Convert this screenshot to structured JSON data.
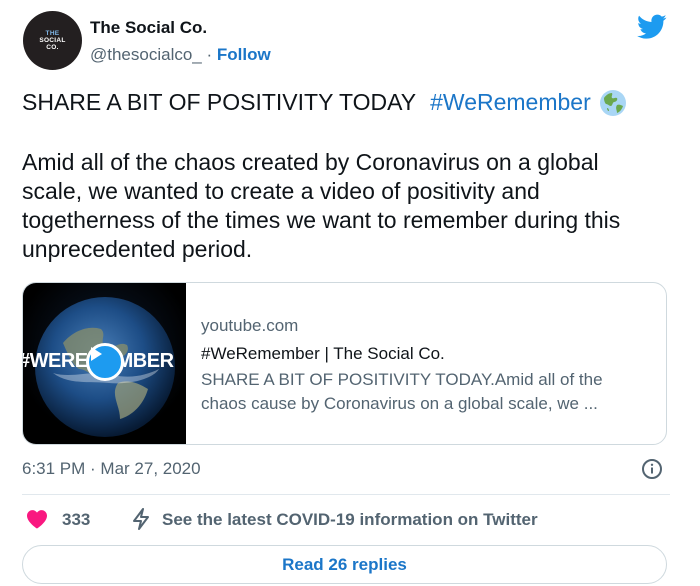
{
  "author": {
    "display_name": "The Social Co.",
    "handle": "@thesocialco_",
    "separator": " · ",
    "follow_label": "Follow",
    "avatar_text": [
      "THE",
      "SOCIAL",
      "CO."
    ]
  },
  "tweet": {
    "headline": "SHARE A BIT OF POSITIVITY TODAY",
    "hashtag": "#WeRemember",
    "body": "Amid all of the chaos created by Coronavirus on a global scale, we wanted to create a video of positivity and togetherness of the times we want to remember during this unprecedented period."
  },
  "link_card": {
    "thumbnail_text": "#WEREMEMBER",
    "domain": "youtube.com",
    "title": "#WeRemember | The Social Co.",
    "description": "SHARE A BIT OF POSITIVITY TODAY.Amid all of the chaos cause by Coronavirus on a global scale, we ..."
  },
  "timestamp": "6:31 PM · Mar 27, 2020",
  "actions": {
    "like_count": "333",
    "covid_link": "See the latest COVID-19 information on Twitter",
    "read_replies": "Read 26 replies"
  },
  "colors": {
    "link_blue": "#1b76c8",
    "twitter_blue": "#1d9bf0",
    "like_pink": "#f91880",
    "muted_text": "#536471"
  },
  "icons": [
    "twitter-bird-icon",
    "globe-icon",
    "play-icon",
    "info-icon",
    "heart-icon",
    "lightning-bolt-icon"
  ]
}
